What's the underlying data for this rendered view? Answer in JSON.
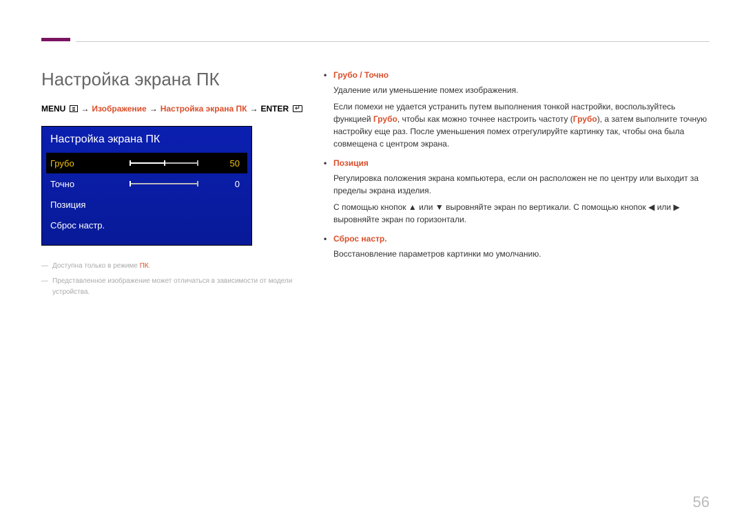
{
  "pageNumber": "56",
  "title": "Настройка экрана ПК",
  "menuPath": {
    "menu": "MENU",
    "step1": "Изображение",
    "step2": "Настройка экрана ПК",
    "enter": "ENTER",
    "arrow": "→"
  },
  "osd": {
    "title": "Настройка экрана ПК",
    "items": [
      {
        "label": "Грубо",
        "value": "50",
        "selected": true,
        "hasSlider": true,
        "sliderFill": 50
      },
      {
        "label": "Точно",
        "value": "0",
        "selected": false,
        "hasSlider": true,
        "sliderFill": 0
      },
      {
        "label": "Позиция",
        "value": "",
        "selected": false,
        "hasSlider": false
      },
      {
        "label": "Сброс настр.",
        "value": "",
        "selected": false,
        "hasSlider": false
      }
    ]
  },
  "footnotes": {
    "n1_pre": "Доступна только в режиме ",
    "n1_pk": "ПК",
    "n1_post": ".",
    "n2": "Представленное изображение может отличаться в зависимости от модели устройства."
  },
  "right": {
    "item1": {
      "head": "Грубо / Точно",
      "p1": "Удаление или уменьшение помех изображения.",
      "p2_a": "Если помехи не удается устранить путем выполнения тонкой настройки, воспользуйтесь функцией ",
      "p2_b": "Грубо",
      "p2_c": ", чтобы как можно точнее настроить частоту (",
      "p2_d": "Грубо",
      "p2_e": "), а затем выполните точную настройку еще раз. После уменьшения помех отрегулируйте картинку так, чтобы она была совмещена с центром экрана."
    },
    "item2": {
      "head": "Позиция",
      "p1": "Регулировка положения экрана компьютера, если он расположен не по центру или выходит за пределы экрана изделия.",
      "p2_a": "С помощью кнопок ",
      "p2_b": " или ",
      "p2_c": " выровняйте экран по вертикали. С помощью кнопок ",
      "p2_d": " или ",
      "p2_e": " выровняйте экран по горизонтали."
    },
    "item3": {
      "head": "Сброс настр.",
      "p1": "Восстановление параметров картинки мо умолчанию."
    }
  }
}
